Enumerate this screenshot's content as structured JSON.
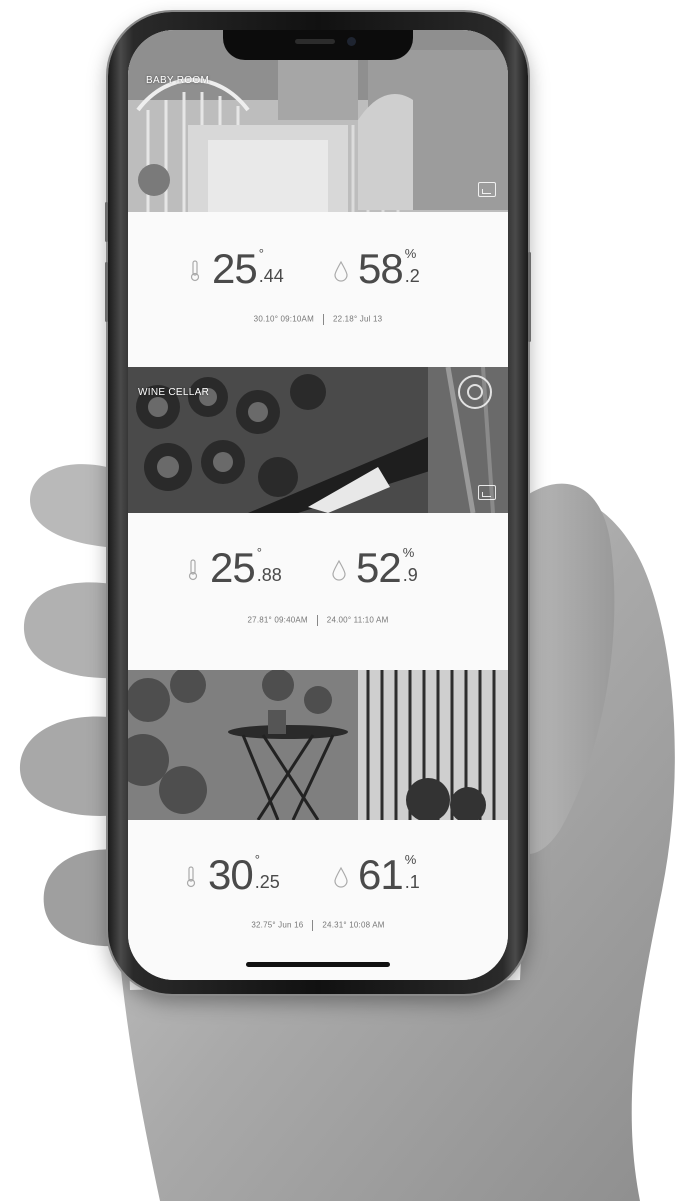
{
  "rooms": [
    {
      "label": "BABY ROOM",
      "temperature": {
        "whole": "25",
        "unit": "°",
        "decimal": ".44"
      },
      "humidity": {
        "whole": "58",
        "unit": "%",
        "decimal": ".2"
      },
      "stat_left": "30.10° 09:10AM",
      "stat_right": "22.18° Jul 13"
    },
    {
      "label": "WINE CELLAR",
      "temperature": {
        "whole": "25",
        "unit": "°",
        "decimal": ".88"
      },
      "humidity": {
        "whole": "52",
        "unit": "%",
        "decimal": ".9"
      },
      "stat_left": "27.81° 09:40AM",
      "stat_right": "24.00° 11:10 AM"
    },
    {
      "label": "",
      "temperature": {
        "whole": "30",
        "unit": "°",
        "decimal": ".25"
      },
      "humidity": {
        "whole": "61",
        "unit": "%",
        "decimal": ".1"
      },
      "stat_left": "32.75° Jun 16",
      "stat_right": "24.31° 10:08 AM"
    }
  ],
  "icons": {
    "temperature": "thermometer-icon",
    "humidity": "droplet-icon",
    "photo": "image-icon",
    "sensor": "sensor-icon"
  },
  "colors": {
    "screen_bg": "#fafafa",
    "text": "#4a4a4a",
    "phone_frame": "#111111"
  }
}
